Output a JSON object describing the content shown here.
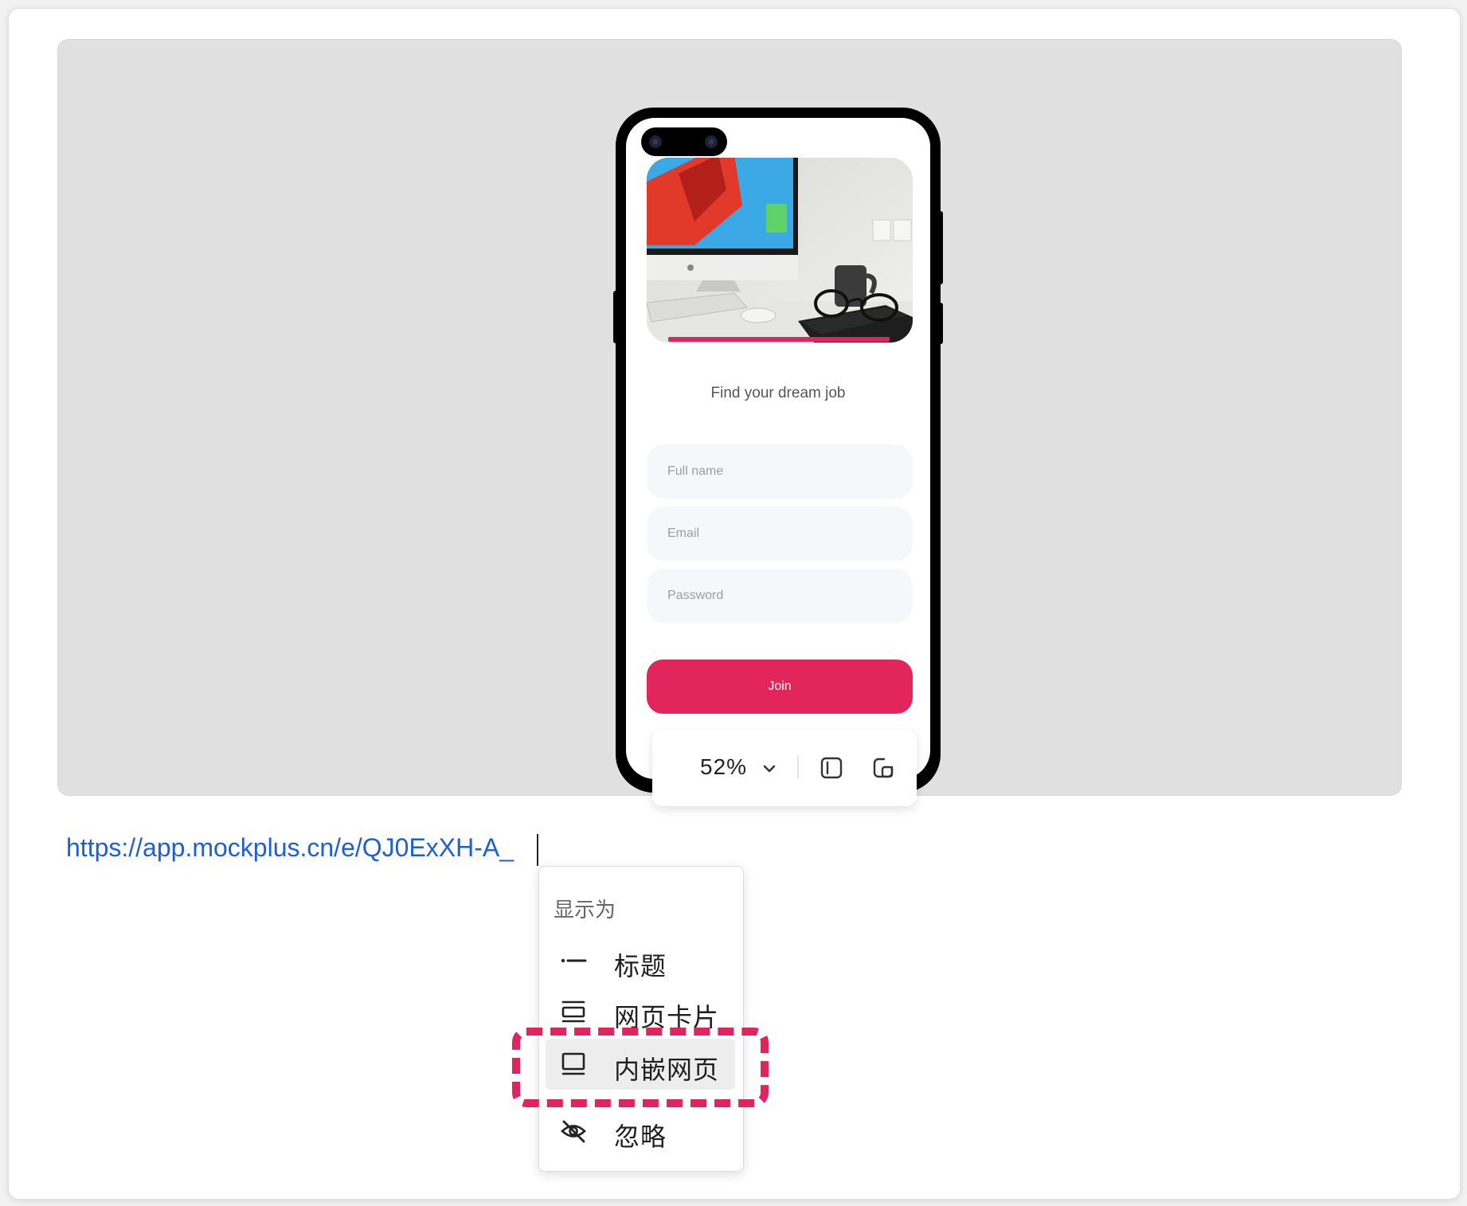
{
  "preview": {
    "tagline": "Find your dream job",
    "fields": [
      {
        "placeholder": "Full name"
      },
      {
        "placeholder": "Email"
      },
      {
        "placeholder": "Password"
      }
    ],
    "join_label": "Join",
    "accent_color": "#e2255a"
  },
  "zoom": {
    "value": "52%",
    "icons": [
      "chevron-down-icon",
      "sidebar-toggle-icon",
      "window-icon"
    ]
  },
  "link": {
    "url": "https://app.mockplus.cn/e/QJ0ExXH-A_"
  },
  "display_menu": {
    "title": "显示为",
    "items": [
      {
        "label": "标题",
        "icon": "title-line-icon",
        "selected": false
      },
      {
        "label": "网页卡片",
        "icon": "card-icon",
        "selected": false
      },
      {
        "label": "内嵌网页",
        "icon": "embed-icon",
        "selected": true
      },
      {
        "label": "忽略",
        "icon": "eye-off-icon",
        "selected": false
      }
    ],
    "highlight_color": "#e0245e"
  }
}
